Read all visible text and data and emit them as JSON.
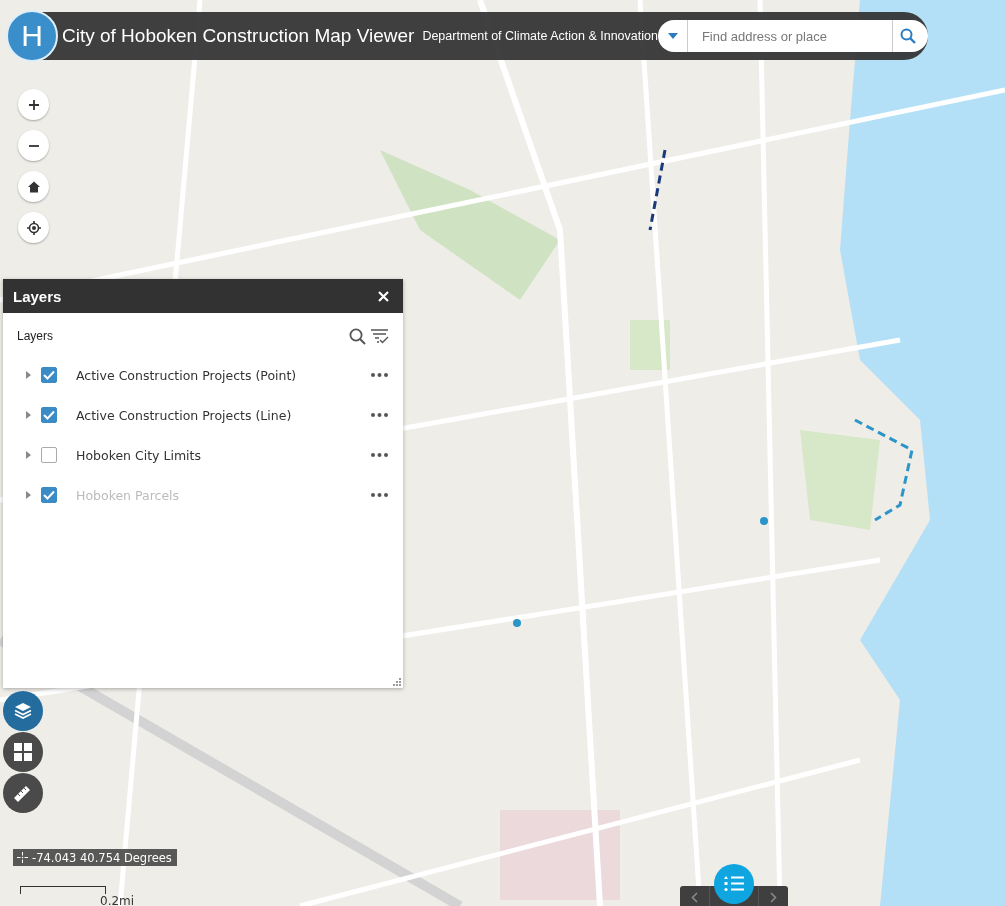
{
  "header": {
    "logo_text": "H",
    "title": "City of Hoboken Construction Map Viewer",
    "subtitle": "Department of Climate Action & Innovation",
    "search": {
      "placeholder": "Find address or place"
    }
  },
  "layers_panel": {
    "title": "Layers",
    "heading": "Layers",
    "layers": [
      {
        "name": "Active Construction Projects (Point)",
        "checked": true,
        "disabled": false
      },
      {
        "name": "Active Construction Projects (Line)",
        "checked": true,
        "disabled": false
      },
      {
        "name": "Hoboken City Limits",
        "checked": false,
        "disabled": false
      },
      {
        "name": "Hoboken Parcels",
        "checked": true,
        "disabled": true
      }
    ]
  },
  "tool_buttons": [
    {
      "kind": "layers",
      "selected": true
    },
    {
      "kind": "widgets",
      "selected": false
    },
    {
      "kind": "measure",
      "selected": false
    }
  ],
  "coordinates": {
    "text": "-74.043 40.754 Degrees"
  },
  "scale_bar": {
    "label": "0.2mi"
  }
}
